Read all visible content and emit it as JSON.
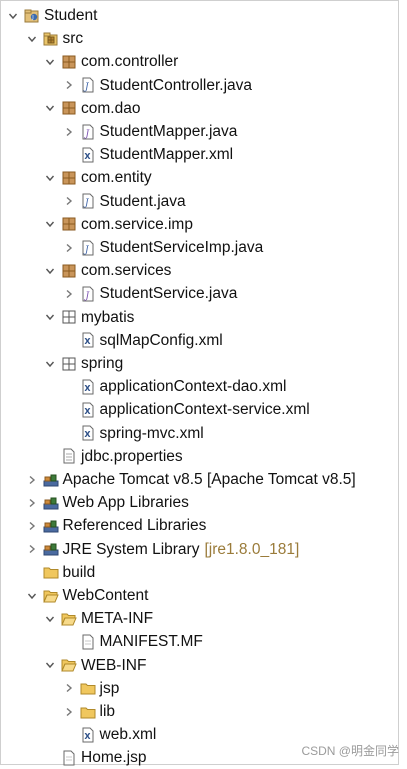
{
  "tree": [
    {
      "name": "project-student",
      "label": "Student",
      "icon": "project-icon",
      "toggle": "expanded",
      "depth": 0
    },
    {
      "name": "folder-src",
      "label": "src",
      "icon": "source-folder-icon",
      "toggle": "expanded",
      "depth": 1
    },
    {
      "name": "package-com-controller",
      "label": "com.controller",
      "icon": "package-icon",
      "toggle": "expanded",
      "depth": 2
    },
    {
      "name": "file-studentcontroller-java",
      "label": "StudentController.java",
      "icon": "java-class-icon",
      "toggle": "collapsed",
      "depth": 3
    },
    {
      "name": "package-com-dao",
      "label": "com.dao",
      "icon": "package-icon",
      "toggle": "expanded",
      "depth": 2
    },
    {
      "name": "file-studentmapper-java",
      "label": "StudentMapper.java",
      "icon": "java-interface-icon",
      "toggle": "collapsed",
      "depth": 3
    },
    {
      "name": "file-studentmapper-xml",
      "label": "StudentMapper.xml",
      "icon": "xml-file-icon",
      "toggle": "none",
      "depth": 3
    },
    {
      "name": "package-com-entity",
      "label": "com.entity",
      "icon": "package-icon",
      "toggle": "expanded",
      "depth": 2
    },
    {
      "name": "file-student-java",
      "label": "Student.java",
      "icon": "java-class-icon",
      "toggle": "collapsed",
      "depth": 3
    },
    {
      "name": "package-com-service-imp",
      "label": "com.service.imp",
      "icon": "package-icon",
      "toggle": "expanded",
      "depth": 2
    },
    {
      "name": "file-studentserviceimp-java",
      "label": "StudentServiceImp.java",
      "icon": "java-class-icon",
      "toggle": "collapsed",
      "depth": 3
    },
    {
      "name": "package-com-services",
      "label": "com.services",
      "icon": "package-icon",
      "toggle": "expanded",
      "depth": 2
    },
    {
      "name": "file-studentservice-java",
      "label": "StudentService.java",
      "icon": "java-interface-icon",
      "toggle": "collapsed",
      "depth": 3
    },
    {
      "name": "package-mybatis",
      "label": "mybatis",
      "icon": "resource-package-icon",
      "toggle": "expanded",
      "depth": 2
    },
    {
      "name": "file-sqlmapconfig-xml",
      "label": "sqlMapConfig.xml",
      "icon": "xml-file-icon",
      "toggle": "none",
      "depth": 3
    },
    {
      "name": "package-spring",
      "label": "spring",
      "icon": "resource-package-icon",
      "toggle": "expanded",
      "depth": 2
    },
    {
      "name": "file-applicationcontext-dao-xml",
      "label": "applicationContext-dao.xml",
      "icon": "xml-file-icon",
      "toggle": "none",
      "depth": 3
    },
    {
      "name": "file-applicationcontext-service-xml",
      "label": "applicationContext-service.xml",
      "icon": "xml-file-icon",
      "toggle": "none",
      "depth": 3
    },
    {
      "name": "file-spring-mvc-xml",
      "label": "spring-mvc.xml",
      "icon": "xml-file-icon",
      "toggle": "none",
      "depth": 3
    },
    {
      "name": "file-jdbc-properties",
      "label": "jdbc.properties",
      "icon": "properties-file-icon",
      "toggle": "none",
      "depth": 2
    },
    {
      "name": "library-apache-tomcat",
      "label": "Apache Tomcat v8.5 [Apache Tomcat v8.5]",
      "icon": "library-icon",
      "toggle": "collapsed",
      "depth": 1
    },
    {
      "name": "library-web-app",
      "label": "Web App Libraries",
      "icon": "library-icon",
      "toggle": "collapsed",
      "depth": 1
    },
    {
      "name": "library-referenced",
      "label": "Referenced Libraries",
      "icon": "library-icon",
      "toggle": "collapsed",
      "depth": 1
    },
    {
      "name": "library-jre-system",
      "label": "JRE System Library",
      "decoration": "[jre1.8.0_181]",
      "icon": "library-icon",
      "toggle": "collapsed",
      "depth": 1
    },
    {
      "name": "folder-build",
      "label": "build",
      "icon": "folder-icon",
      "toggle": "none",
      "depth": 1
    },
    {
      "name": "folder-webcontent",
      "label": "WebContent",
      "icon": "folder-open-icon",
      "toggle": "expanded",
      "depth": 1
    },
    {
      "name": "folder-meta-inf",
      "label": "META-INF",
      "icon": "folder-open-icon",
      "toggle": "expanded",
      "depth": 2
    },
    {
      "name": "file-manifest-mf",
      "label": "MANIFEST.MF",
      "icon": "text-file-icon",
      "toggle": "none",
      "depth": 3
    },
    {
      "name": "folder-web-inf",
      "label": "WEB-INF",
      "icon": "folder-open-icon",
      "toggle": "expanded",
      "depth": 2
    },
    {
      "name": "folder-jsp",
      "label": "jsp",
      "icon": "folder-icon",
      "toggle": "collapsed",
      "depth": 3
    },
    {
      "name": "folder-lib",
      "label": "lib",
      "icon": "folder-icon",
      "toggle": "collapsed",
      "depth": 3
    },
    {
      "name": "file-web-xml",
      "label": "web.xml",
      "icon": "xml-file-icon",
      "toggle": "none",
      "depth": 3
    },
    {
      "name": "file-home-jsp",
      "label": "Home.jsp",
      "icon": "text-file-icon",
      "toggle": "none",
      "depth": 2
    }
  ],
  "watermark": "CSDN @明金同学",
  "colors": {
    "package": "#b07a2a",
    "folder": "#e7b84f",
    "library": "#4a6aa0",
    "java": "#3d63a8",
    "xml": "#6a6a6a",
    "decoration": "#9a7b3a"
  }
}
